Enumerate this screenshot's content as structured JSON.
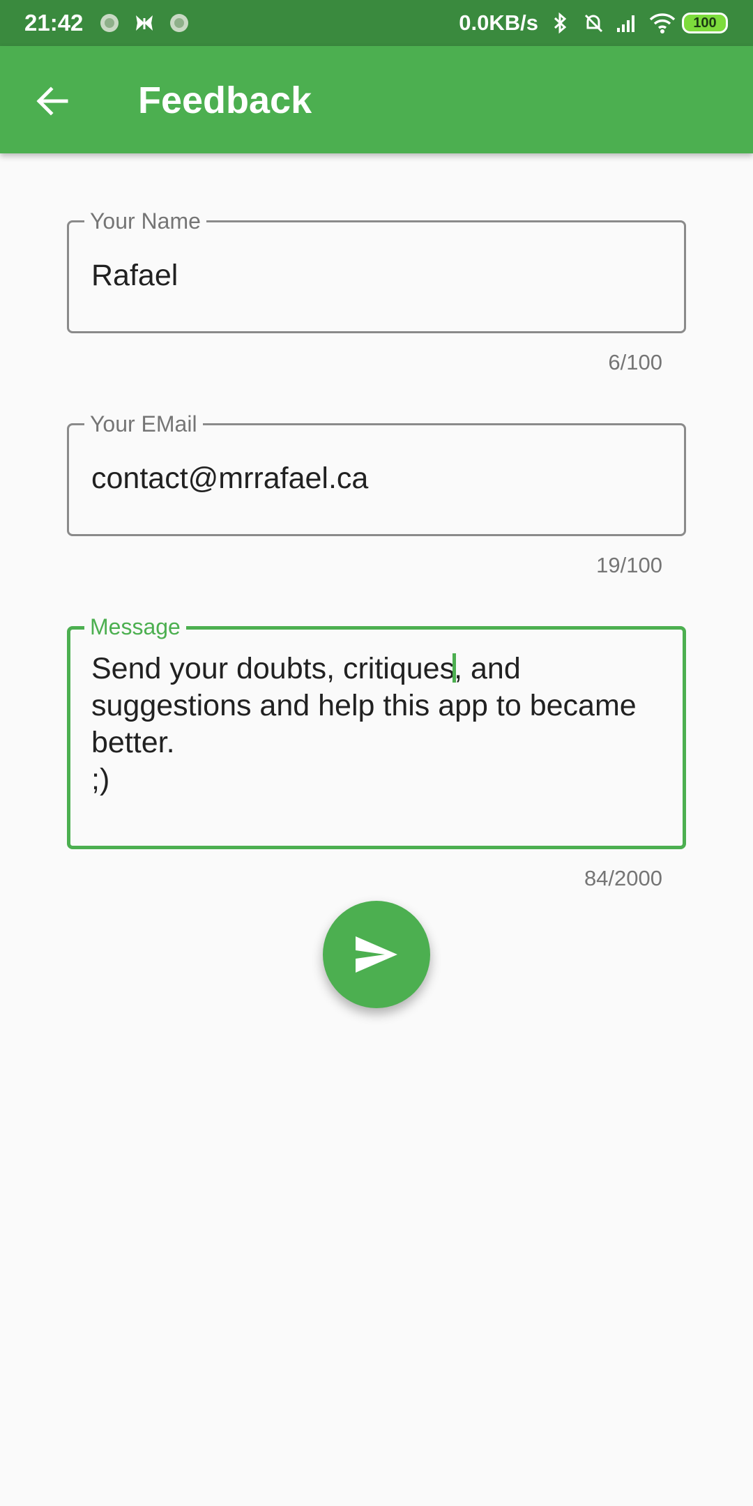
{
  "status_bar": {
    "time": "21:42",
    "net_speed": "0.0KB/s",
    "battery": "100",
    "left_icons": [
      "app-notification-icon",
      "butterfly-icon",
      "app-notification-icon"
    ],
    "right_icons": [
      "bluetooth-icon",
      "mute-alarm-icon",
      "signal-icon",
      "wifi-icon",
      "battery-icon"
    ]
  },
  "app_bar": {
    "title": "Feedback",
    "back_icon": "arrow-back-icon",
    "color": "#4caf50"
  },
  "form": {
    "name": {
      "label": "Your Name",
      "value": "Rafael",
      "counter": "6/100"
    },
    "email": {
      "label": "Your EMail",
      "value": "contact@mrrafael.ca",
      "counter": "19/100"
    },
    "message": {
      "label": "Message",
      "value_before_caret": "Send your doubts, critiques",
      "value_after_caret": ", and\nsuggestions and help this app to became better.\n;)",
      "counter": "84/2000",
      "focused": true
    }
  },
  "send_button": {
    "icon": "send-icon",
    "color": "#4caf50"
  }
}
